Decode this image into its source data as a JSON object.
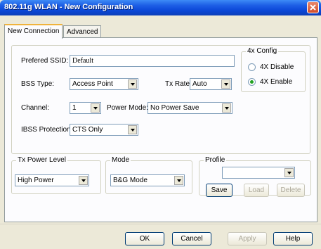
{
  "window": {
    "title": "802.11g WLAN - New Configuration"
  },
  "tabs": [
    {
      "label": "New Connection"
    },
    {
      "label": "Advanced"
    }
  ],
  "form": {
    "ssid_label": "Prefered SSID:",
    "ssid_value": "Default",
    "bss_label": "BSS Type:",
    "bss_value": "Access Point",
    "txrate_label": "Tx Rate:",
    "txrate_value": "Auto",
    "channel_label": "Channel:",
    "channel_value": "1",
    "powermode_label": "Power Mode:",
    "powermode_value": "No Power Save",
    "ibss_label": "IBSS Protection:",
    "ibss_value": "CTS Only"
  },
  "config4x": {
    "title": "4x Config",
    "options": [
      {
        "label": "4X Disable",
        "checked": false
      },
      {
        "label": "4X Enable",
        "checked": true
      }
    ]
  },
  "txpower": {
    "title": "Tx Power Level",
    "value": "High Power"
  },
  "mode": {
    "title": "Mode",
    "value": "B&G Mode"
  },
  "profile": {
    "title": "Profile",
    "value": "",
    "save_label": "Save",
    "load_label": "Load",
    "delete_label": "Delete"
  },
  "footer": {
    "ok_label": "OK",
    "cancel_label": "Cancel",
    "apply_label": "Apply",
    "help_label": "Help"
  },
  "icons": {
    "close": "close-icon",
    "dropdown": "chevron-down-icon"
  }
}
